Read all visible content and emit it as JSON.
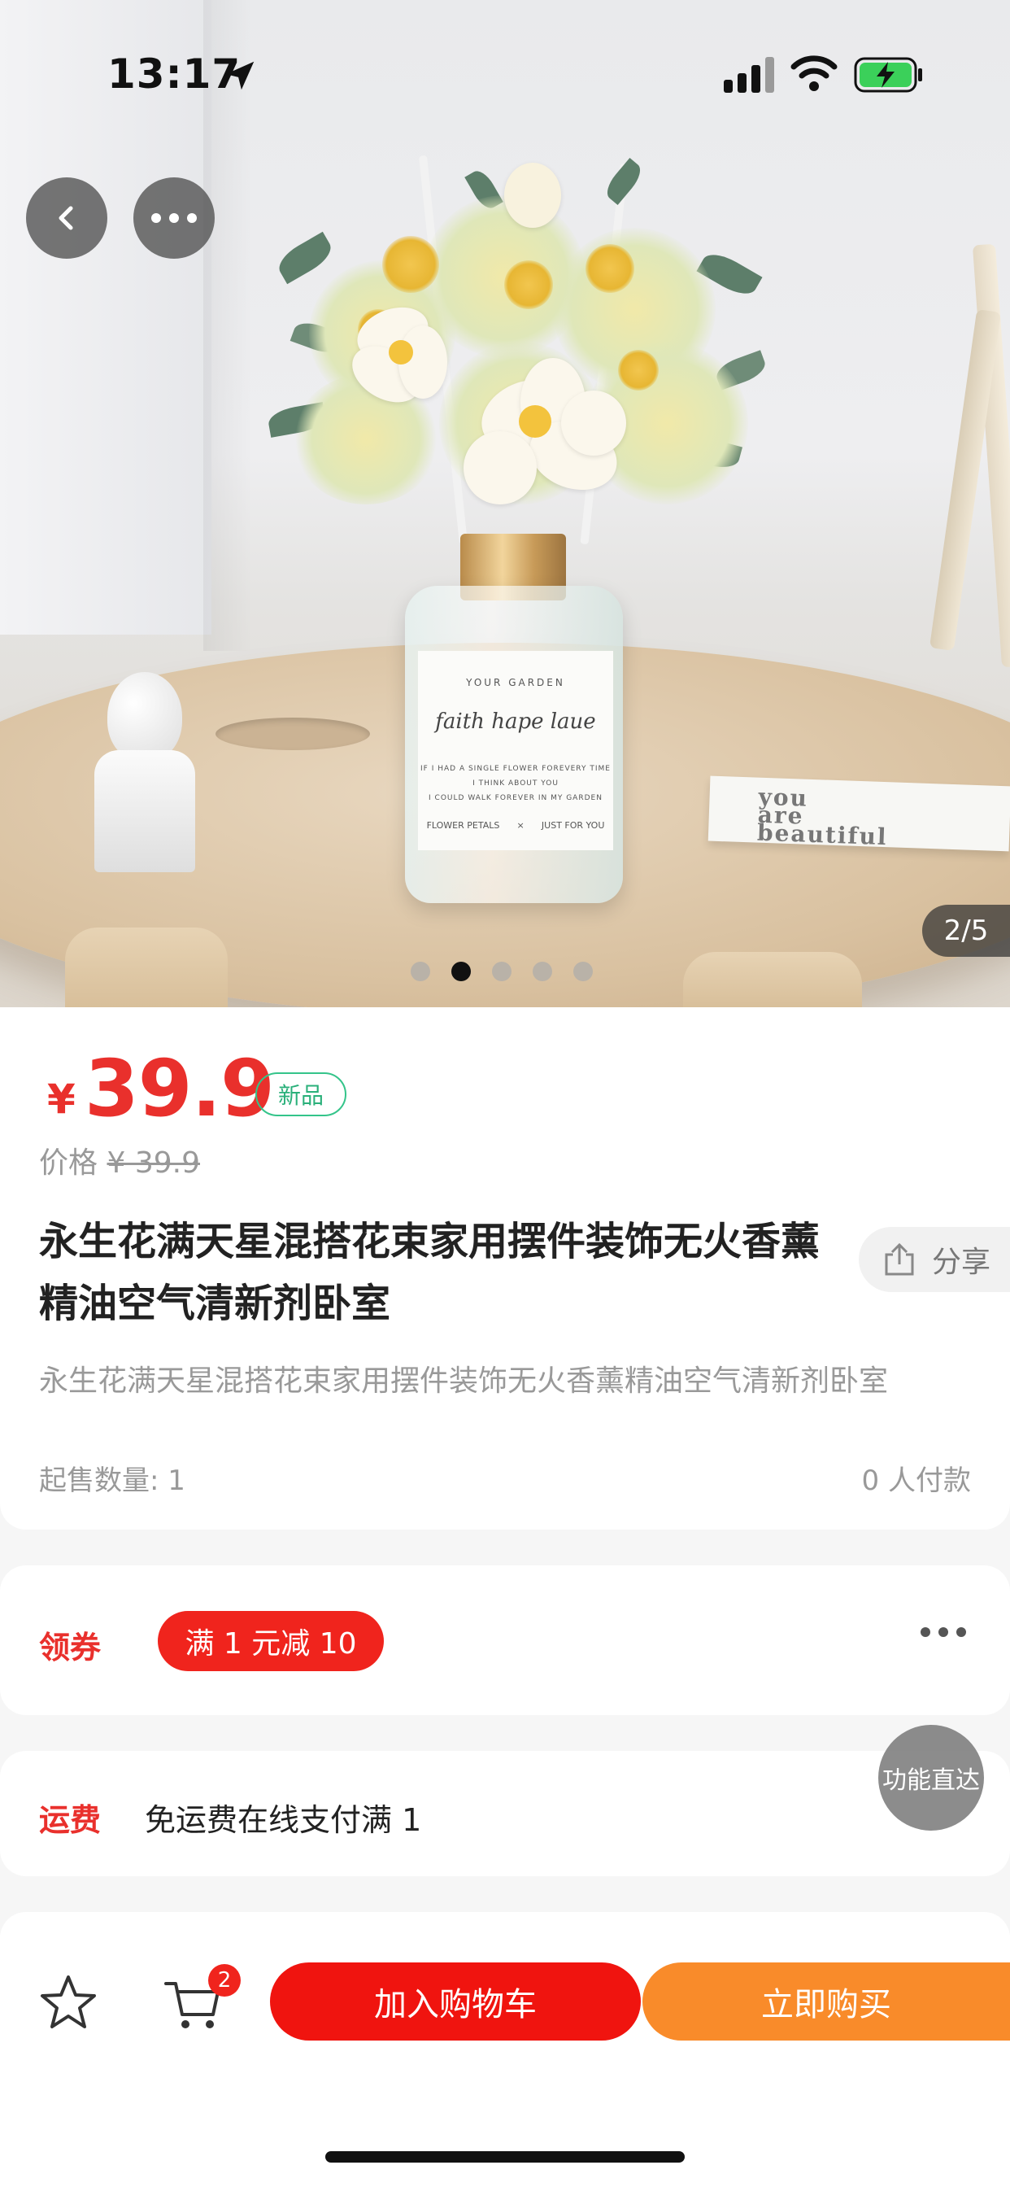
{
  "status_bar": {
    "time": "13:17",
    "image_counter": "2/5"
  },
  "hero": {
    "label_brand": "YOUR GARDEN",
    "label_script": "faith hape laue",
    "label_lines": [
      "IF I HAD A SINGLE FLOWER FOREVERY TIME",
      "I THINK ABOUT YOU",
      "I COULD WALK FOREVER IN MY GARDEN"
    ],
    "label_left": "FLOWER PETALS",
    "label_x": "×",
    "label_right": "JUST FOR YOU",
    "card_lines": [
      "you",
      "are",
      "beautiful"
    ],
    "active_dot": 1,
    "dot_count": 5
  },
  "product": {
    "currency": "¥",
    "price": "39.9",
    "badge": "新品",
    "orig_prefix": "价格",
    "orig_price": "¥ 39.9",
    "title": "永生花满天星混搭花束家用摆件装饰无火香薰精油空气清新剂卧室",
    "share": "分享",
    "subtitle": "永生花满天星混搭花束家用摆件装饰无火香薰精油空气清新剂卧室",
    "min_qty": "起售数量: 1",
    "paid": "0 人付款"
  },
  "coupon": {
    "label": "领券",
    "chip": "满 1 元减 10"
  },
  "shipping": {
    "label": "运费",
    "text": "免运费在线支付满 1",
    "bubble": "功能直达"
  },
  "bottom": {
    "cart_count": "2",
    "add_to_cart": "加入购物车",
    "buy_now": "立即购买"
  },
  "colors": {
    "accent_red": "#f0241d",
    "buy_orange": "#f98b2a",
    "new_green": "#34c48a"
  }
}
